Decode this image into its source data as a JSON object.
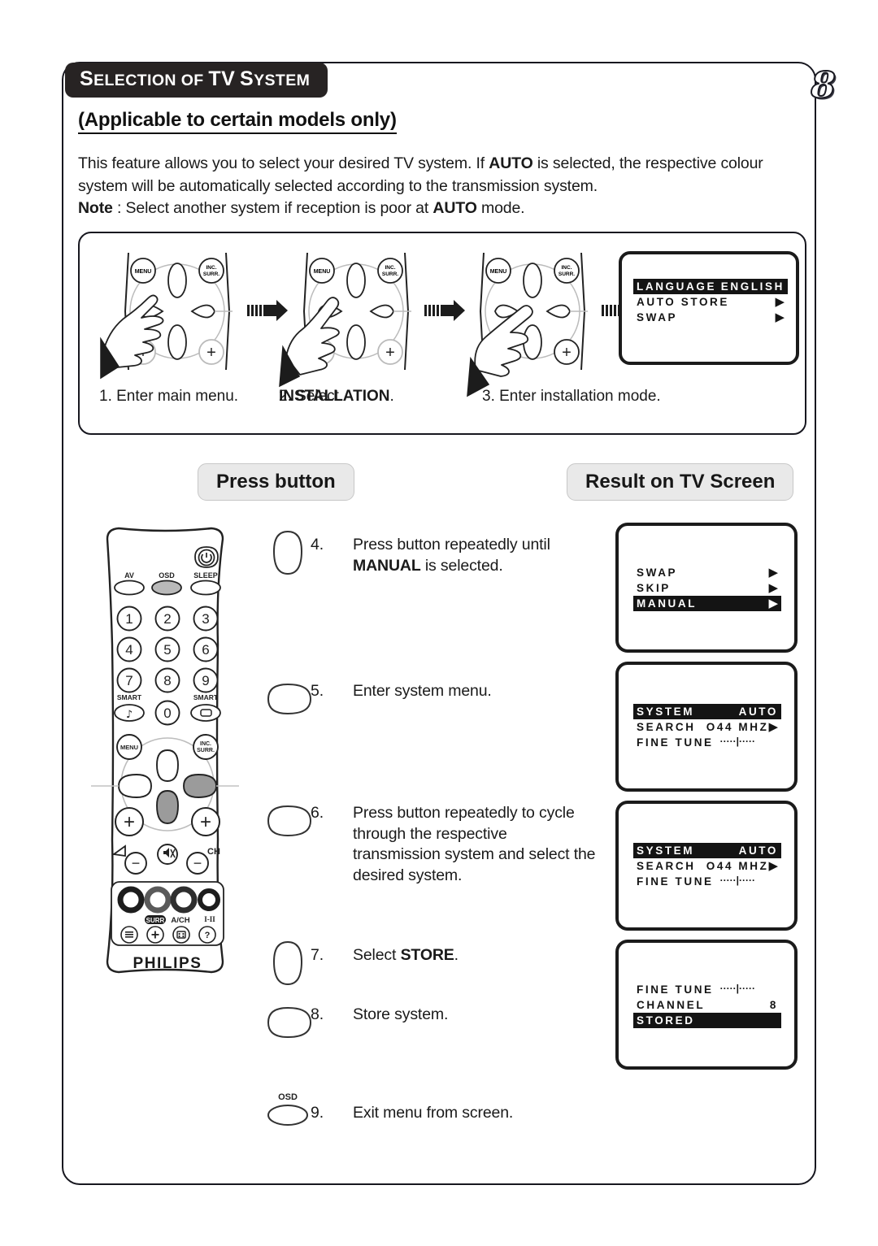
{
  "header": {
    "title_caps1": "S",
    "title_rest1": "ELECTION",
    "title_of": "OF",
    "title_caps2": "TV",
    "title_caps3": "S",
    "title_rest3": "YSTEM",
    "title_plain": "SELECTION OF TV SYSTEM",
    "page_number": "8",
    "bar_color": "#272323"
  },
  "subtitle": "(Applicable to certain models only)",
  "intro": {
    "line1_a": "This feature allows you to select your desired TV system. If ",
    "line1_b": "AUTO",
    "line1_c": " is selected, the respective colour system will be automatically selected according to the transmission system.",
    "note_label": "Note",
    "note_a": " : Select another system if reception is poor at ",
    "note_b": "AUTO",
    "note_c": " mode."
  },
  "top_diagram": {
    "steps": [
      {
        "n": "1.",
        "caption": "Enter main menu.",
        "pressed": "MENU"
      },
      {
        "n": "2.",
        "caption_a": "Select ",
        "caption_b": "INSTALLATION",
        "caption_c": ".",
        "pressed": "UP"
      },
      {
        "n": "3.",
        "caption": "Enter installation mode.",
        "pressed": "RIGHT"
      }
    ],
    "caption1": "1. Enter main menu.",
    "caption2_pre": "2. Select ",
    "caption2_bold": "INSTALLATION",
    "caption2_post": ".",
    "caption3": "3. Enter installation mode.",
    "remote_labels": {
      "menu": "MENU",
      "inc_surr_1": "INC.",
      "inc_surr_2": "SURR."
    },
    "tv_menu": [
      {
        "label": "LANGUAGE",
        "value": "ENGLISH",
        "highlight": true,
        "arrow": false
      },
      {
        "label": "AUTO STORE",
        "value": "",
        "highlight": false,
        "arrow": true
      },
      {
        "label": "SWAP",
        "value": "",
        "highlight": false,
        "arrow": true
      }
    ]
  },
  "bands": {
    "press": "Press button",
    "result": "Result on TV Screen",
    "bg_color": "#e9e9e9"
  },
  "remote": {
    "brand": "PHILIPS",
    "top_labels": {
      "av": "AV",
      "osd": "OSD",
      "sleep": "SLEEP"
    },
    "numbers": [
      "1",
      "2",
      "3",
      "4",
      "5",
      "6",
      "7",
      "8",
      "9",
      "0"
    ],
    "smart_left": "SMART",
    "smart_right": "SMART",
    "smart_left_glyph": "♪",
    "smart_right_glyph": "▭",
    "nav": {
      "menu": "MENU",
      "inc": "INC.",
      "surr": "SURR."
    },
    "vol_glyph": "◸",
    "ch_label": "CH",
    "plus": "+",
    "minus": "−",
    "mute_glyph": "ὐ7",
    "teletext_labels": {
      "surr": "SURR",
      "ach": "A/CH",
      "i_ii": "I-II"
    }
  },
  "steps": [
    {
      "num": "4.",
      "text_a": "Press button repeatedly until ",
      "text_b": "MANUAL",
      "text_c": " is selected.",
      "button": "up-teardrop"
    },
    {
      "num": "5.",
      "text_a": "Enter system menu.",
      "text_b": "",
      "text_c": "",
      "button": "right-teardrop"
    },
    {
      "num": "6.",
      "text_a": "Press  button repeatedly to cycle through the respective transmission system and select the desired system.",
      "text_b": "",
      "text_c": "",
      "button": "right-teardrop"
    },
    {
      "num": "7.",
      "text_a": "Select ",
      "text_b": "STORE",
      "text_c": ".",
      "button": "up-teardrop"
    },
    {
      "num": "8.",
      "text_a": "Store system.",
      "text_b": "",
      "text_c": "",
      "button": "right-teardrop"
    },
    {
      "num": "9.",
      "text_a": "Exit menu from screen.",
      "text_b": "",
      "text_c": "",
      "button": "osd-oval",
      "button_label": "OSD"
    }
  ],
  "tv_screens": [
    {
      "id": "screen-manual",
      "rows": [
        {
          "label": "SWAP",
          "value": "",
          "highlight": false,
          "arrow": true
        },
        {
          "label": "SKIP",
          "value": "",
          "highlight": false,
          "arrow": true
        },
        {
          "label": "MANUAL",
          "value": "",
          "highlight": true,
          "arrow": true
        }
      ]
    },
    {
      "id": "screen-system-1",
      "rows": [
        {
          "label": "SYSTEM",
          "value": "AUTO",
          "highlight": true,
          "arrow": false
        },
        {
          "label": "SEARCH",
          "value": "O44 MHZ",
          "highlight": false,
          "arrow": true
        },
        {
          "label": "FINE TUNE",
          "value": "",
          "highlight": false,
          "arrow": false,
          "slider": true
        }
      ]
    },
    {
      "id": "screen-system-2",
      "rows": [
        {
          "label": "SYSTEM",
          "value": "AUTO",
          "highlight": true,
          "arrow": false
        },
        {
          "label": "SEARCH",
          "value": "O44 MHZ",
          "highlight": false,
          "arrow": true
        },
        {
          "label": "FINE TUNE",
          "value": "",
          "highlight": false,
          "arrow": false,
          "slider": true
        }
      ]
    },
    {
      "id": "screen-stored",
      "rows": [
        {
          "label": "FINE TUNE",
          "value": "",
          "highlight": false,
          "arrow": false,
          "slider": true
        },
        {
          "label": "CHANNEL",
          "value": "8",
          "highlight": false,
          "arrow": false
        },
        {
          "label": "STORED",
          "value": "",
          "highlight": true,
          "arrow": false
        }
      ]
    }
  ],
  "glyphs": {
    "triangle_right": "▶",
    "slider": "·····|·····"
  }
}
